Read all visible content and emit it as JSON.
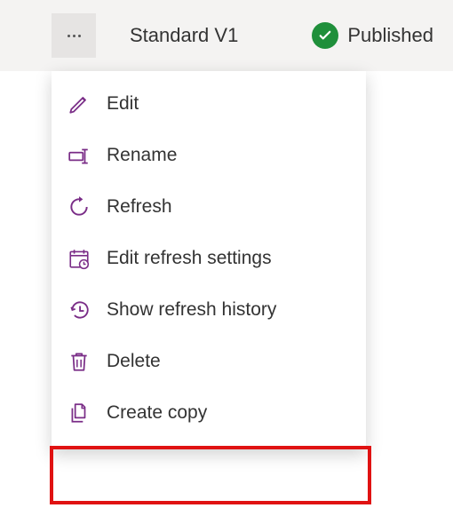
{
  "header": {
    "title": "Standard V1",
    "status_label": "Published"
  },
  "menu": {
    "items": [
      {
        "icon": "edit-icon",
        "label": "Edit"
      },
      {
        "icon": "rename-icon",
        "label": "Rename"
      },
      {
        "icon": "refresh-icon",
        "label": "Refresh"
      },
      {
        "icon": "refresh-settings-icon",
        "label": "Edit refresh settings"
      },
      {
        "icon": "refresh-history-icon",
        "label": "Show refresh history"
      },
      {
        "icon": "delete-icon",
        "label": "Delete"
      },
      {
        "icon": "create-copy-icon",
        "label": "Create copy"
      }
    ],
    "highlighted_index": 6
  },
  "colors": {
    "icon_accent": "#7a2d87",
    "status_badge": "#1f8f3b",
    "highlight_border": "#e01212"
  }
}
